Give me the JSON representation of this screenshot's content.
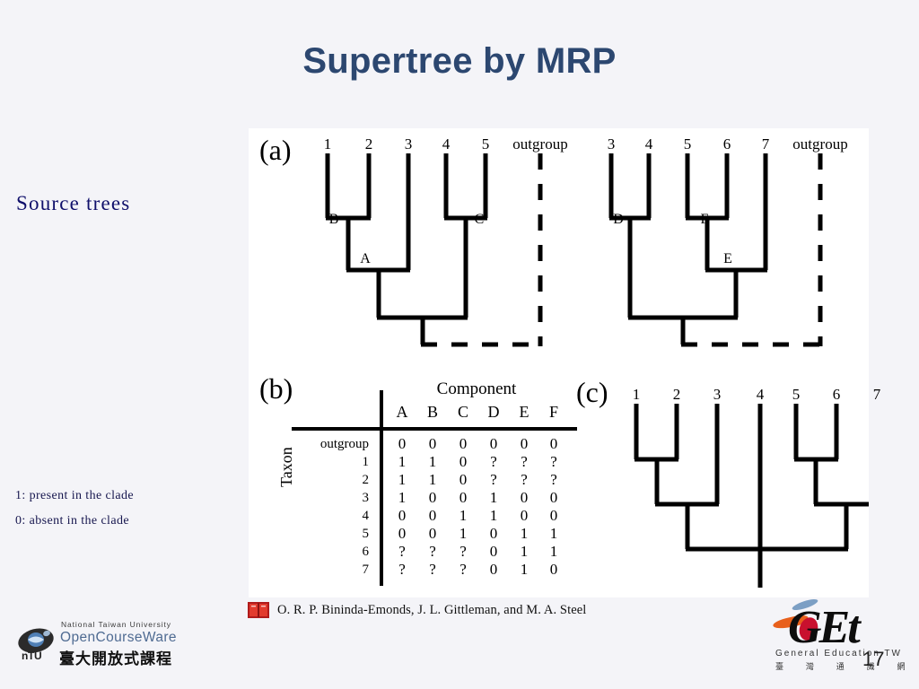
{
  "slide": {
    "title": "Supertree by MRP",
    "page_number": "17",
    "title_color": "#2c4770",
    "background_color": "#f4f4f8",
    "panel_background": "#ffffff"
  },
  "sidebar": {
    "source_trees_label": "Source trees",
    "legend": [
      "1: present in the clade",
      "0: absent in the clade"
    ]
  },
  "figure": {
    "panels": {
      "a": "(a)",
      "b": "(b)",
      "c": "(c)"
    },
    "tree_a_left": {
      "tips": [
        "1",
        "2",
        "3",
        "4",
        "5",
        "outgroup"
      ],
      "nodes": [
        "B",
        "A",
        "C"
      ]
    },
    "tree_a_right": {
      "tips": [
        "3",
        "4",
        "5",
        "6",
        "7",
        "outgroup"
      ],
      "nodes": [
        "D",
        "F",
        "E"
      ]
    },
    "tree_c": {
      "tips": [
        "1",
        "2",
        "3",
        "4",
        "5",
        "6",
        "7"
      ]
    },
    "matrix": {
      "column_group_title": "Component",
      "row_group_title": "Taxon",
      "columns": [
        "A",
        "B",
        "C",
        "D",
        "E",
        "F"
      ],
      "rows": [
        {
          "taxon": "outgroup",
          "values": [
            "0",
            "0",
            "0",
            "0",
            "0",
            "0"
          ]
        },
        {
          "taxon": "1",
          "values": [
            "1",
            "1",
            "0",
            "?",
            "?",
            "?"
          ]
        },
        {
          "taxon": "2",
          "values": [
            "1",
            "1",
            "0",
            "?",
            "?",
            "?"
          ]
        },
        {
          "taxon": "3",
          "values": [
            "1",
            "0",
            "0",
            "1",
            "0",
            "0"
          ]
        },
        {
          "taxon": "4",
          "values": [
            "0",
            "0",
            "1",
            "1",
            "0",
            "0"
          ]
        },
        {
          "taxon": "5",
          "values": [
            "0",
            "0",
            "1",
            "0",
            "1",
            "1"
          ]
        },
        {
          "taxon": "6",
          "values": [
            "?",
            "?",
            "?",
            "0",
            "1",
            "1"
          ]
        },
        {
          "taxon": "7",
          "values": [
            "?",
            "?",
            "?",
            "0",
            "1",
            "0"
          ]
        }
      ]
    }
  },
  "citation": {
    "text": "O. R. P. Bininda-Emonds, J. L. Gittleman, and M. A. Steel",
    "icon": "book-icon"
  },
  "ocw_logo": {
    "university_en": "National Taiwan University",
    "program_en": "OpenCourseWare",
    "program_cn": "臺大開放式課程",
    "abbrev": "nTU"
  },
  "get_logo": {
    "wordmark": "GEt",
    "tagline_en": "General Education TW",
    "tagline_cn": "臺 灣 通 識 網"
  }
}
